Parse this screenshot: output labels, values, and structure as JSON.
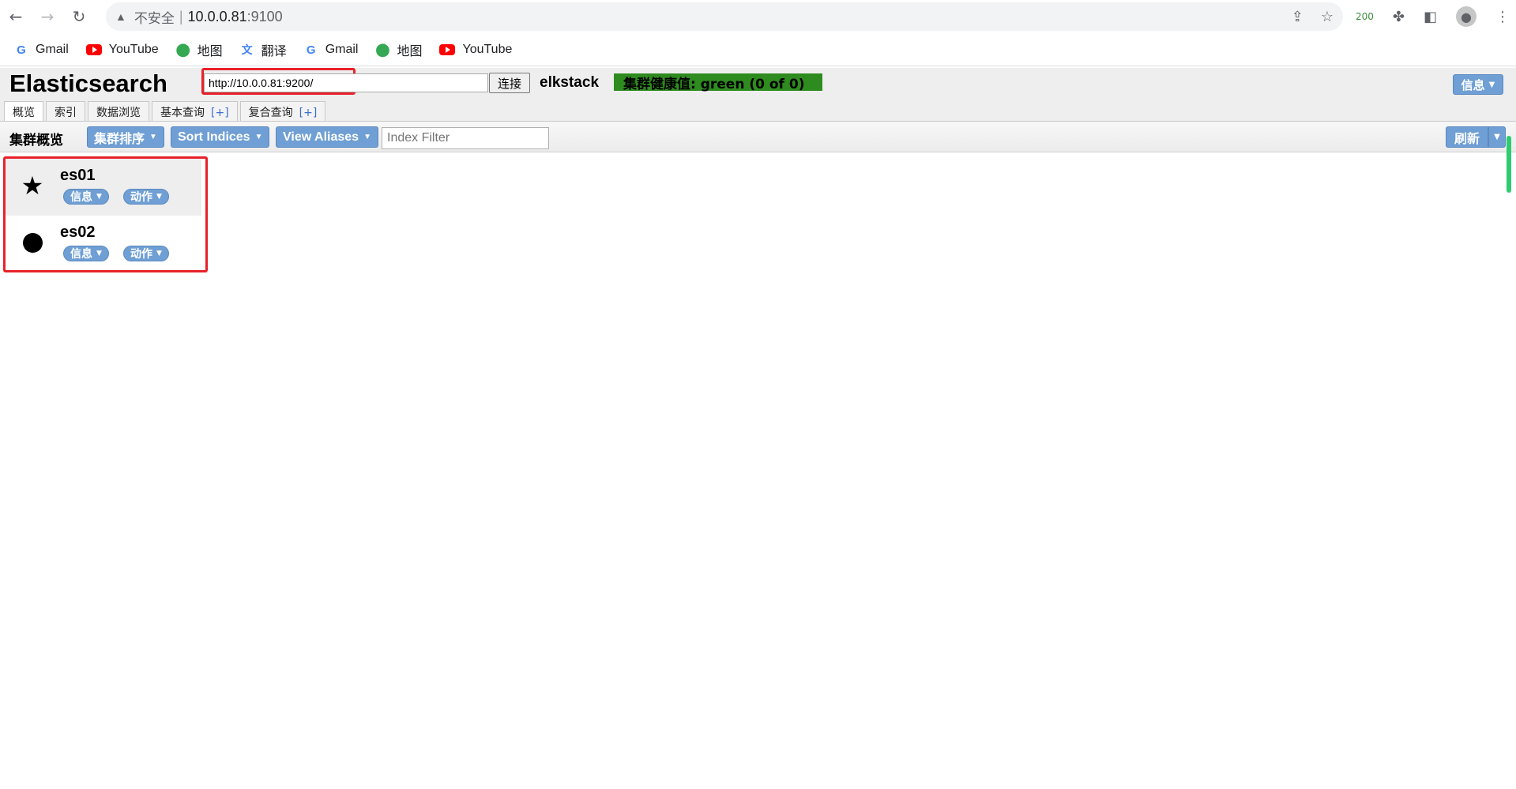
{
  "browser": {
    "back_icon": "←",
    "forward_icon": "→",
    "reload_icon": "↻",
    "security_label": "不安全",
    "separator": "|",
    "url_host": "10.0.0.81",
    "url_port": ":9100",
    "ext_badge": "200"
  },
  "bookmarks": [
    {
      "label": "Gmail",
      "icon": "google-icon"
    },
    {
      "label": "YouTube",
      "icon": "youtube-icon"
    },
    {
      "label": "地图",
      "icon": "maps-icon"
    },
    {
      "label": "翻译",
      "icon": "translate-icon"
    },
    {
      "label": "Gmail",
      "icon": "google-icon"
    },
    {
      "label": "地图",
      "icon": "maps-icon"
    },
    {
      "label": "YouTube",
      "icon": "youtube-icon"
    }
  ],
  "app": {
    "title": "Elasticsearch",
    "url_value": "http://10.0.0.81:9200/",
    "connect_label": "连接",
    "cluster_name": "elkstack",
    "health_text": "集群健康值: green (0 of 0)",
    "health_color": "#2e8b1f",
    "info_label": "信息",
    "tabs": [
      {
        "label": "概览",
        "plus": ""
      },
      {
        "label": "索引",
        "plus": ""
      },
      {
        "label": "数据浏览",
        "plus": ""
      },
      {
        "label": "基本查询",
        "plus": "[+]"
      },
      {
        "label": "复合查询",
        "plus": "[+]"
      }
    ]
  },
  "toolbar": {
    "title": "集群概览",
    "sort_cluster": "集群排序",
    "sort_indices": "Sort Indices",
    "view_aliases": "View Aliases",
    "filter_placeholder": "Index Filter",
    "refresh": "刷新"
  },
  "nodes": [
    {
      "name": "es01",
      "role": "master",
      "icon": "star-icon",
      "info": "信息",
      "action": "动作"
    },
    {
      "name": "es02",
      "role": "data",
      "icon": "circle-icon",
      "info": "信息",
      "action": "动作"
    }
  ],
  "colors": {
    "accent_button": "#6f9fd4",
    "highlight_box": "#e8222a"
  }
}
